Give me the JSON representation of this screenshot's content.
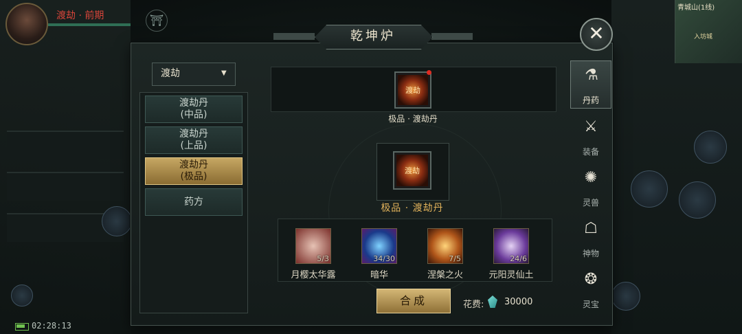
{
  "hud": {
    "player_name": "渡劫 · 前期",
    "clock": "02:28:13",
    "minimap_title": "青城山(1线)",
    "minimap_sub": "入坊城"
  },
  "panel": {
    "title": "乾坤炉",
    "close": "✕"
  },
  "dropdown": {
    "label": "渡劫",
    "arrow": "▼"
  },
  "recipe_list": [
    {
      "line1": "渡劫丹",
      "line2": "(中品)",
      "active": false
    },
    {
      "line1": "渡劫丹",
      "line2": "(上品)",
      "active": false
    },
    {
      "line1": "渡劫丹",
      "line2": "(极品)",
      "active": true
    },
    {
      "line1": "药方",
      "line2": "",
      "active": false
    }
  ],
  "result": {
    "top_item_name": "极品 · 渡劫丹",
    "main_item_name": "极品 · 渡劫丹",
    "item_glyph": "渡劫"
  },
  "materials": [
    {
      "name": "月樱太华露",
      "count": "5/3",
      "color": "#b4524a"
    },
    {
      "name": "暗华",
      "count": "34/30",
      "color": "#3b6fd0"
    },
    {
      "name": "涅槃之火",
      "count": "7/5",
      "color": "#d08a28"
    },
    {
      "name": "元阳灵仙土",
      "count": "24/6",
      "color": "#8c5fb0"
    }
  ],
  "actions": {
    "synthesize": "合成",
    "cost_label": "花费:",
    "cost_value": "30000"
  },
  "tabs": [
    {
      "label": "丹药",
      "icon": "mortar-icon",
      "glyph": "⚗",
      "active": true
    },
    {
      "label": "装备",
      "icon": "sword-icon",
      "glyph": "⚔",
      "active": false
    },
    {
      "label": "灵兽",
      "icon": "paw-icon",
      "glyph": "✺",
      "active": false
    },
    {
      "label": "神物",
      "icon": "fan-icon",
      "glyph": "☖",
      "active": false
    },
    {
      "label": "灵宝",
      "icon": "swirl-icon",
      "glyph": "❂",
      "active": false
    }
  ]
}
